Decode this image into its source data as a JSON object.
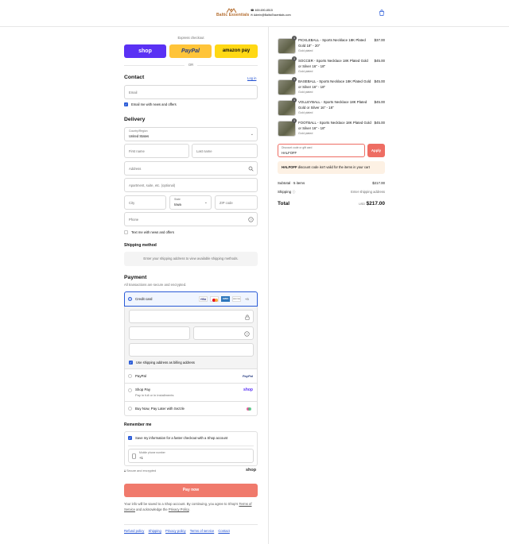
{
  "header": {
    "logo_text": "Baltic Essentials",
    "phone": "469-690-8515",
    "email": "Admin@BalticEssentials.com"
  },
  "express": {
    "label": "Express checkout",
    "shop_label": "shop",
    "paypal_label": "PayPal",
    "amazon_label": "amazon pay",
    "or_label": "OR"
  },
  "contact": {
    "title": "Contact",
    "login_link": "Log in",
    "email_placeholder": "Email",
    "email_news_label": "Email me with news and offers"
  },
  "delivery": {
    "title": "Delivery",
    "country_label": "Country/Region",
    "country_value": "United States",
    "first_name_placeholder": "First name",
    "last_name_placeholder": "Last name",
    "address_placeholder": "Address",
    "apartment_placeholder": "Apartment, suite, etc. (optional)",
    "city_placeholder": "City",
    "state_label": "State",
    "state_value": "Iowa",
    "zip_placeholder": "ZIP code",
    "phone_placeholder": "Phone",
    "text_news_label": "Text me with news and offers"
  },
  "shipping_method": {
    "title": "Shipping method",
    "message": "Enter your shipping address to view available shipping methods."
  },
  "payment": {
    "title": "Payment",
    "subtitle": "All transactions are secure and encrypted.",
    "credit_card_label": "Credit card",
    "card_brands": [
      "VISA",
      "MC",
      "AMEX",
      "DISCOVER"
    ],
    "more_cards": "+3",
    "billing_same_label": "Use shipping address as billing address",
    "paypal_label": "PayPal",
    "paypal_logo": "PayPal",
    "shop_pay_label": "Shop Pay",
    "shop_pay_sub": "Pay in full or in installments",
    "shop_pay_logo": "shop",
    "sezzle_label": "Buy Now, Pay Later with Sezzle"
  },
  "remember": {
    "title": "Remember me",
    "save_label": "Save my information for a faster checkout with a Shop account",
    "mobile_label": "Mobile phone number",
    "mobile_value": "+1",
    "secure_label": "Secure and encrypted",
    "shop_logo": "shop"
  },
  "pay_now": "Pay now",
  "disclaimer": {
    "text1": "Your info will be saved to a Shop account. By continuing, you agree to Shop's",
    "terms": "Terms of Service",
    "text2": "and acknowledge the",
    "privacy": "Privacy Policy",
    "end": "."
  },
  "footer_links": [
    "Refund policy",
    "Shipping",
    "Privacy policy",
    "Terms of service",
    "Contact"
  ],
  "cart": {
    "items": [
      {
        "qty": "1",
        "title": "PICKLEBALL - Sports Necklace 18K Plated Gold 18\" - 20\"",
        "variant": "Gold plated",
        "price": "$37.00"
      },
      {
        "qty": "1",
        "title": "SOCCER - Sports Necklace 18K Plated Gold or Silver 16\" - 18\"",
        "variant": "Gold plated",
        "price": "$45.00"
      },
      {
        "qty": "1",
        "title": "BASEBALL - Sports Necklace 18K Plated Gold or Silver 16\" - 18\"",
        "variant": "Gold plated",
        "price": "$45.00"
      },
      {
        "qty": "1",
        "title": "VOLLEYBALL - Sports Necklace 18K Plated Gold or Silver 16\" - 18\"",
        "variant": "Gold plated",
        "price": "$45.00"
      },
      {
        "qty": "1",
        "title": "FOOTBALL - Sports Necklace 18K Plated Gold or Silver 16\" - 18\"",
        "variant": "Gold plated",
        "price": "$45.00"
      }
    ],
    "discount_label": "Discount code or gift card",
    "discount_value": "HALFOFF",
    "apply_label": "Apply",
    "error_code": "HALFOFF",
    "error_text": "discount code isn't valid for the items in your cart",
    "subtotal_label": "Subtotal · 5 items",
    "subtotal_value": "$217.00",
    "shipping_label": "Shipping",
    "shipping_value": "Enter shipping address",
    "total_label": "Total",
    "currency": "USD",
    "total_value": "$217.00"
  },
  "colors": {
    "shop_purple": "#5a31f4",
    "paypal_yellow": "#ffc439",
    "amazon_yellow": "#ffd814",
    "primary_blue": "#2a5bd7",
    "pay_button": "#f07a6c",
    "apply_button": "#ee6d63",
    "error_bg": "#fdf1e4"
  }
}
